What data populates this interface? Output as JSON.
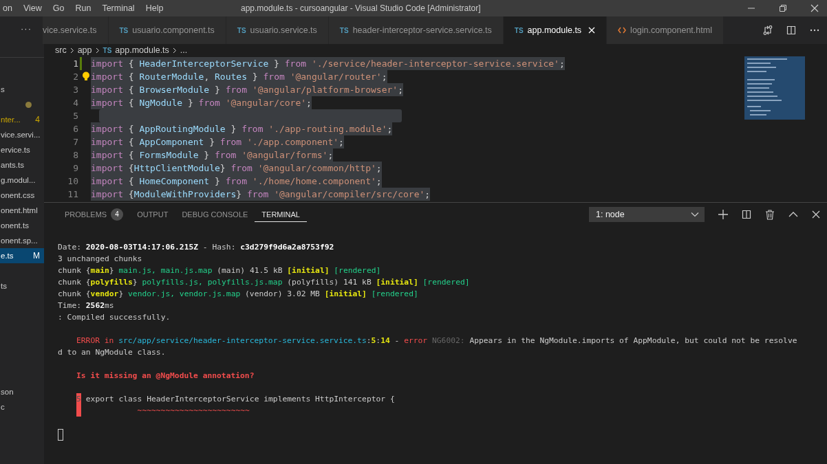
{
  "menu": [
    "on",
    "View",
    "Go",
    "Run",
    "Terminal",
    "Help"
  ],
  "window": {
    "title": "app.module.ts - cursoangular - Visual Studio Code [Administrator]"
  },
  "sidebar": {
    "more": "···",
    "groups": [
      [
        {
          "text": "s"
        },
        {
          "modified": true
        },
        {
          "text": "nter...",
          "warning": true,
          "badge": "4"
        },
        {
          "text": "vice.servi..."
        },
        {
          "text": "ervice.ts"
        },
        {
          "text": "ants.ts"
        },
        {
          "text": "g.modul..."
        },
        {
          "text": "onent.css"
        },
        {
          "text": "onent.html"
        },
        {
          "text": "onent.ts"
        },
        {
          "text": "onent.sp..."
        },
        {
          "text": "e.ts",
          "badge": "M",
          "selected": true
        }
      ],
      [
        {
          "text": "ts"
        }
      ],
      [
        {
          "text": "son"
        },
        {
          "text": "c"
        }
      ]
    ]
  },
  "tabs": [
    {
      "label": "vice.service.ts",
      "kind": "plain",
      "selected": false
    },
    {
      "label": "usuario.component.ts",
      "kind": "ts",
      "badge": "TS",
      "selected": false
    },
    {
      "label": "usuario.service.ts",
      "kind": "ts",
      "badge": "TS",
      "selected": false
    },
    {
      "label": "header-interceptor-service.service.ts",
      "kind": "ts",
      "badge": "TS",
      "selected": false
    },
    {
      "label": "app.module.ts",
      "kind": "ts",
      "badge": "TS",
      "selected": true
    },
    {
      "label": "login.component.html",
      "kind": "html",
      "selected": false
    }
  ],
  "breadcrumb": [
    {
      "text": "src"
    },
    {
      "text": "app"
    },
    {
      "text": "app.module.ts",
      "badge": "TS"
    },
    {
      "text": "..."
    }
  ],
  "editor": {
    "lines": [
      {
        "number": "1",
        "selected": true,
        "git_modified": true,
        "segments": [
          {
            "text": "import",
            "kind": "kw"
          },
          {
            "text": " { ",
            "kind": "p"
          },
          {
            "text": "HeaderInterceptorService",
            "kind": "id"
          },
          {
            "text": " } ",
            "kind": "p"
          },
          {
            "text": "from ",
            "kind": "kw"
          },
          {
            "text": "'./service/header-interceptor-service.service'",
            "kind": "str"
          },
          {
            "text": ";",
            "kind": "p"
          }
        ]
      },
      {
        "number": "2",
        "selected": true,
        "lightbulb": true,
        "segments": [
          {
            "text": "import",
            "kind": "kw"
          },
          {
            "text": " { ",
            "kind": "p"
          },
          {
            "text": "RouterModule",
            "kind": "id"
          },
          {
            "text": ", ",
            "kind": "p"
          },
          {
            "text": "Routes",
            "kind": "id"
          },
          {
            "text": " } ",
            "kind": "p"
          },
          {
            "text": "from ",
            "kind": "kw"
          },
          {
            "text": "'@angular/router'",
            "kind": "str"
          },
          {
            "text": ";",
            "kind": "p"
          }
        ]
      },
      {
        "number": "3",
        "selected": true,
        "segments": [
          {
            "text": "import",
            "kind": "kw"
          },
          {
            "text": " { ",
            "kind": "p"
          },
          {
            "text": "BrowserModule",
            "kind": "id"
          },
          {
            "text": " } ",
            "kind": "p"
          },
          {
            "text": "from ",
            "kind": "kw"
          },
          {
            "text": "'@angular/platform-browser'",
            "kind": "str"
          },
          {
            "text": ";",
            "kind": "p"
          }
        ]
      },
      {
        "number": "4",
        "selected": true,
        "segments": [
          {
            "text": "import",
            "kind": "kw"
          },
          {
            "text": " { ",
            "kind": "p"
          },
          {
            "text": "NgModule",
            "kind": "id"
          },
          {
            "text": " } ",
            "kind": "p"
          },
          {
            "text": "from ",
            "kind": "kw"
          },
          {
            "text": "'@angular/core'",
            "kind": "str"
          },
          {
            "text": ";",
            "kind": "p"
          }
        ]
      },
      {
        "number": "5",
        "selected": true
      },
      {
        "number": "6",
        "selected": true,
        "segments": [
          {
            "text": "import",
            "kind": "kw"
          },
          {
            "text": " { ",
            "kind": "p"
          },
          {
            "text": "AppRoutingModule",
            "kind": "id"
          },
          {
            "text": " } ",
            "kind": "p"
          },
          {
            "text": "from ",
            "kind": "kw"
          },
          {
            "text": "'./app-routing.module'",
            "kind": "str"
          },
          {
            "text": ";",
            "kind": "p"
          }
        ]
      },
      {
        "number": "7",
        "selected": true,
        "segments": [
          {
            "text": "import",
            "kind": "kw"
          },
          {
            "text": " { ",
            "kind": "p"
          },
          {
            "text": "AppComponent",
            "kind": "id"
          },
          {
            "text": " } ",
            "kind": "p"
          },
          {
            "text": "from ",
            "kind": "kw"
          },
          {
            "text": "'./app.component'",
            "kind": "str"
          },
          {
            "text": ";",
            "kind": "p"
          }
        ]
      },
      {
        "number": "8",
        "selected": true,
        "segments": [
          {
            "text": "import",
            "kind": "kw"
          },
          {
            "text": " { ",
            "kind": "p"
          },
          {
            "text": "FormsModule",
            "kind": "id"
          },
          {
            "text": " } ",
            "kind": "p"
          },
          {
            "text": "from ",
            "kind": "kw"
          },
          {
            "text": "'@angular/forms'",
            "kind": "str"
          },
          {
            "text": ";",
            "kind": "p"
          }
        ]
      },
      {
        "number": "9",
        "selected": true,
        "segments": [
          {
            "text": "import",
            "kind": "kw"
          },
          {
            "text": " {",
            "kind": "p"
          },
          {
            "text": "HttpClientModule",
            "kind": "id"
          },
          {
            "text": "} ",
            "kind": "p"
          },
          {
            "text": "from ",
            "kind": "kw"
          },
          {
            "text": "'@angular/common/http'",
            "kind": "str"
          },
          {
            "text": ";",
            "kind": "p"
          }
        ]
      },
      {
        "number": "10",
        "selected": true,
        "segments": [
          {
            "text": "import",
            "kind": "kw"
          },
          {
            "text": " { ",
            "kind": "p"
          },
          {
            "text": "HomeComponent",
            "kind": "id"
          },
          {
            "text": " } ",
            "kind": "p"
          },
          {
            "text": "from ",
            "kind": "kw"
          },
          {
            "text": "'./home/home.component'",
            "kind": "str"
          },
          {
            "text": ";",
            "kind": "p"
          }
        ]
      },
      {
        "number": "11",
        "selected": true,
        "segments": [
          {
            "text": "import",
            "kind": "kw"
          },
          {
            "text": " {",
            "kind": "p"
          },
          {
            "text": "ModuleWithProviders",
            "kind": "id"
          },
          {
            "text": "} ",
            "kind": "p"
          },
          {
            "text": "from ",
            "kind": "kw"
          },
          {
            "text": "'@angular/compiler/src/core'",
            "kind": "str"
          },
          {
            "text": ";",
            "kind": "p"
          }
        ]
      }
    ]
  },
  "panel": {
    "tabs": [
      {
        "label": "PROBLEMS",
        "badge": "4",
        "selected": false
      },
      {
        "label": "OUTPUT",
        "selected": false
      },
      {
        "label": "DEBUG CONSOLE",
        "selected": false
      },
      {
        "label": "TERMINAL",
        "selected": true
      }
    ],
    "terminal_select": "1: node",
    "terminal": {
      "cursor": true,
      "lines": [
        {
          "segments": [
            {
              "text": "Date: ",
              "kind": "plain"
            },
            {
              "text": "2020-08-03T14:17:06.215Z",
              "kind": "bold"
            },
            {
              "text": " - Hash: ",
              "kind": "plain"
            },
            {
              "text": "c3d279f9d6a2a8753f92",
              "kind": "bold"
            }
          ]
        },
        {
          "segments": [
            {
              "text": "3 unchanged chunks",
              "kind": "plain"
            }
          ]
        },
        {
          "segments": [
            {
              "text": "chunk {",
              "kind": "plain"
            },
            {
              "text": "main",
              "kind": "yellow"
            },
            {
              "text": "} ",
              "kind": "plain"
            },
            {
              "text": "main.js, main.js.map",
              "kind": "green"
            },
            {
              "text": " (main) 41.5 kB ",
              "kind": "plain"
            },
            {
              "text": "[initial]",
              "kind": "yellow"
            },
            {
              "text": " [rendered]",
              "kind": "green"
            }
          ]
        },
        {
          "segments": [
            {
              "text": "chunk {",
              "kind": "plain"
            },
            {
              "text": "polyfills",
              "kind": "yellow"
            },
            {
              "text": "} ",
              "kind": "plain"
            },
            {
              "text": "polyfills.js, polyfills.js.map",
              "kind": "green"
            },
            {
              "text": " (polyfills) 141 kB ",
              "kind": "plain"
            },
            {
              "text": "[initial]",
              "kind": "yellow"
            },
            {
              "text": " [rendered]",
              "kind": "green"
            }
          ]
        },
        {
          "segments": [
            {
              "text": "chunk {",
              "kind": "plain"
            },
            {
              "text": "vendor",
              "kind": "yellow"
            },
            {
              "text": "} ",
              "kind": "plain"
            },
            {
              "text": "vendor.js, vendor.js.map",
              "kind": "green"
            },
            {
              "text": " (vendor) 3.02 MB ",
              "kind": "plain"
            },
            {
              "text": "[initial]",
              "kind": "yellow"
            },
            {
              "text": " [rendered]",
              "kind": "green"
            }
          ]
        },
        {
          "segments": [
            {
              "text": "Time: ",
              "kind": "plain"
            },
            {
              "text": "2562",
              "kind": "bold"
            },
            {
              "text": "ms",
              "kind": "plain"
            }
          ]
        },
        {
          "segments": [
            {
              "text": ": Compiled successfully.",
              "kind": "plain"
            }
          ]
        },
        {
          "space_before": true,
          "indent": true,
          "segments": [
            {
              "text": "ERROR in ",
              "kind": "red"
            },
            {
              "text": "src/app/service/header-interceptor-service.service.ts",
              "kind": "cyan"
            },
            {
              "text": ":",
              "kind": "plain"
            },
            {
              "text": "5",
              "kind": "yellow"
            },
            {
              "text": ":",
              "kind": "plain"
            },
            {
              "text": "14",
              "kind": "yellow"
            },
            {
              "text": " - ",
              "kind": "plain"
            },
            {
              "text": "error",
              "kind": "red"
            },
            {
              "text": " NG6002: ",
              "kind": "gray"
            },
            {
              "text": "Appears in the NgModule.imports of AppModule, but could not be resolve",
              "kind": "plain"
            }
          ]
        },
        {
          "segments": [
            {
              "text": "d to an NgModule class.",
              "kind": "plain"
            }
          ]
        },
        {
          "space_before": true,
          "indent": true,
          "segments": [
            {
              "text": "Is it missing an @NgModule annotation?",
              "kind": "redbold"
            }
          ]
        },
        {
          "space_before": true,
          "indent": true,
          "gutter": "5",
          "segments": [
            {
              "text": " export class HeaderInterceptorService implements HttpInterceptor {",
              "kind": "plain"
            }
          ]
        },
        {
          "indent": true,
          "gutter_mark": true,
          "segments": [
            {
              "text": "            ~~~~~~~~~~~~~~~~~~~~~~~~",
              "kind": "squiggle"
            }
          ]
        }
      ]
    }
  }
}
